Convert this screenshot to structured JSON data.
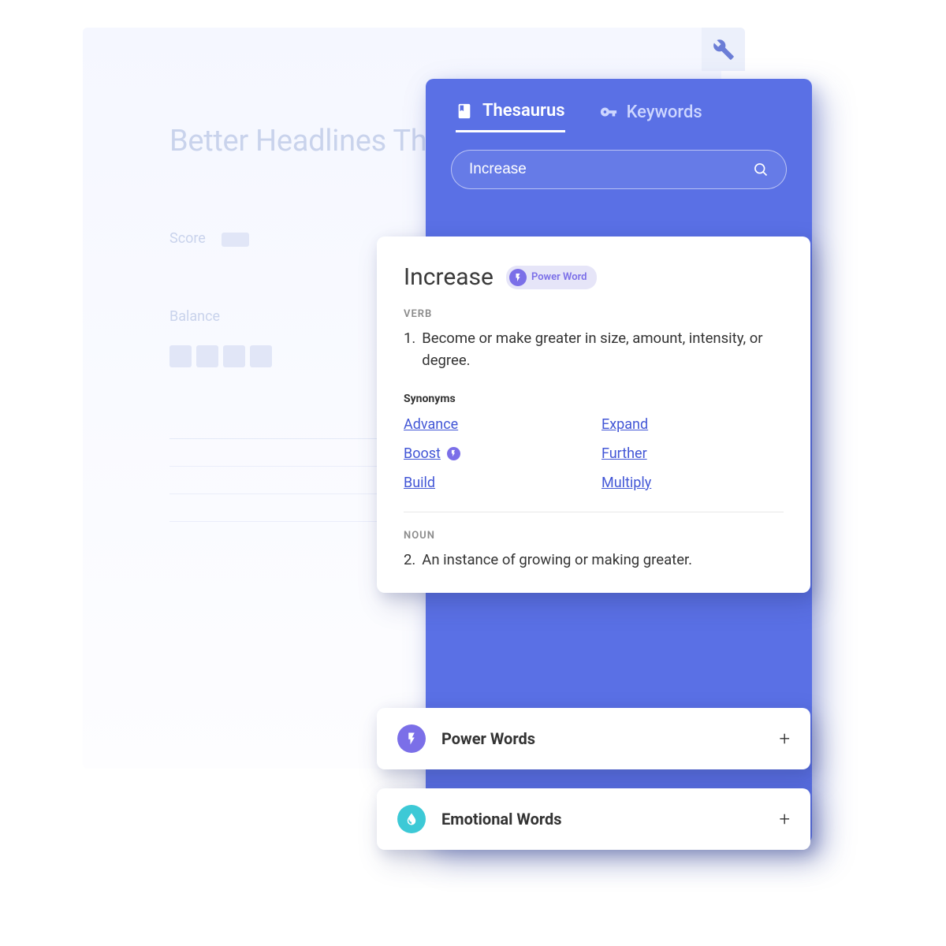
{
  "background": {
    "title": "Better Headlines That Traffic",
    "score_label": "Score",
    "balance_label": "Balance"
  },
  "panel": {
    "tabs": {
      "thesaurus": "Thesaurus",
      "keywords": "Keywords"
    },
    "search_value": "Increase"
  },
  "result": {
    "word": "Increase",
    "badge": "Power Word",
    "pos1": "VERB",
    "def1_num": "1.",
    "def1": "Become or make greater in size, amount, intensity, or degree.",
    "synonyms_label": "Synonyms",
    "synonyms": {
      "s1": "Advance",
      "s2": "Expand",
      "s3": "Boost",
      "s4": "Further",
      "s5": "Build",
      "s6": "Multiply"
    },
    "pos2": "NOUN",
    "def2_num": "2.",
    "def2": "An instance of growing or making greater."
  },
  "rows": {
    "power": "Power Words",
    "emotional": "Emotional Words"
  }
}
